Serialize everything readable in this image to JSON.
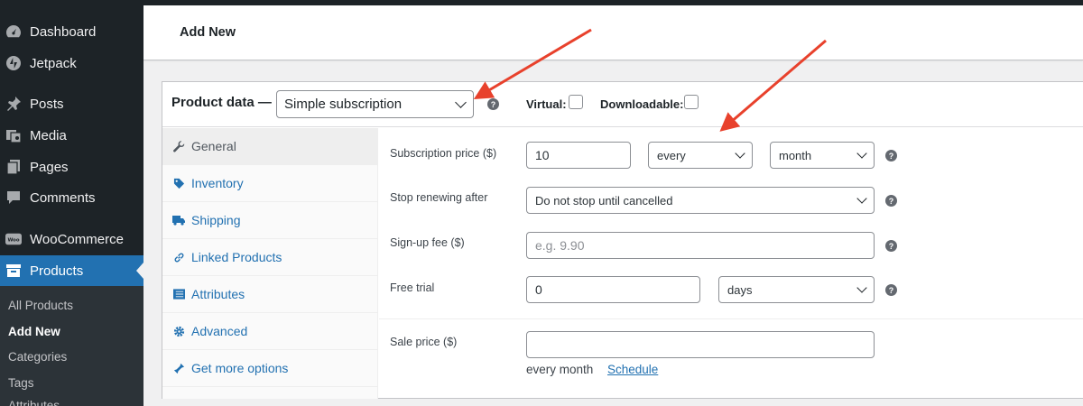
{
  "sidebar": {
    "items": [
      {
        "label": "Dashboard",
        "icon": "dashboard-icon"
      },
      {
        "label": "Jetpack",
        "icon": "jetpack-icon"
      },
      {
        "label": "Posts",
        "icon": "pin-icon"
      },
      {
        "label": "Media",
        "icon": "media-icon"
      },
      {
        "label": "Pages",
        "icon": "pages-icon"
      },
      {
        "label": "Comments",
        "icon": "comment-icon"
      },
      {
        "label": "WooCommerce",
        "icon": "woo-icon"
      },
      {
        "label": "Products",
        "icon": "archive-icon"
      }
    ],
    "submenu": [
      "All Products",
      "Add New",
      "Categories",
      "Tags",
      "Attributes"
    ],
    "active_color": "#2271b1"
  },
  "header": {
    "title": "Add New"
  },
  "product_data": {
    "label": "Product data —",
    "type": "Simple subscription",
    "virtual_label": "Virtual:",
    "downloadable_label": "Downloadable:",
    "virtual_checked": false,
    "downloadable_checked": false
  },
  "tabs": [
    {
      "label": "General",
      "icon": "wrench-icon"
    },
    {
      "label": "Inventory",
      "icon": "tag-icon"
    },
    {
      "label": "Shipping",
      "icon": "truck-icon"
    },
    {
      "label": "Linked Products",
      "icon": "link-icon"
    },
    {
      "label": "Attributes",
      "icon": "table-icon"
    },
    {
      "label": "Advanced",
      "icon": "gear-icon"
    },
    {
      "label": "Get more options",
      "icon": "plugin-icon"
    }
  ],
  "fields": {
    "subscription_price": {
      "label": "Subscription price ($)",
      "value": "10",
      "interval": "every",
      "period": "month"
    },
    "stop_renewing": {
      "label": "Stop renewing after",
      "value": "Do not stop until cancelled"
    },
    "signup_fee": {
      "label": "Sign-up fee ($)",
      "placeholder": "e.g. 9.90"
    },
    "free_trial": {
      "label": "Free trial",
      "value": "0",
      "unit": "days"
    },
    "sale_price": {
      "label": "Sale price ($)",
      "value": "",
      "description": "every month",
      "schedule_link": "Schedule"
    }
  },
  "annotation_color": "#e8412c"
}
